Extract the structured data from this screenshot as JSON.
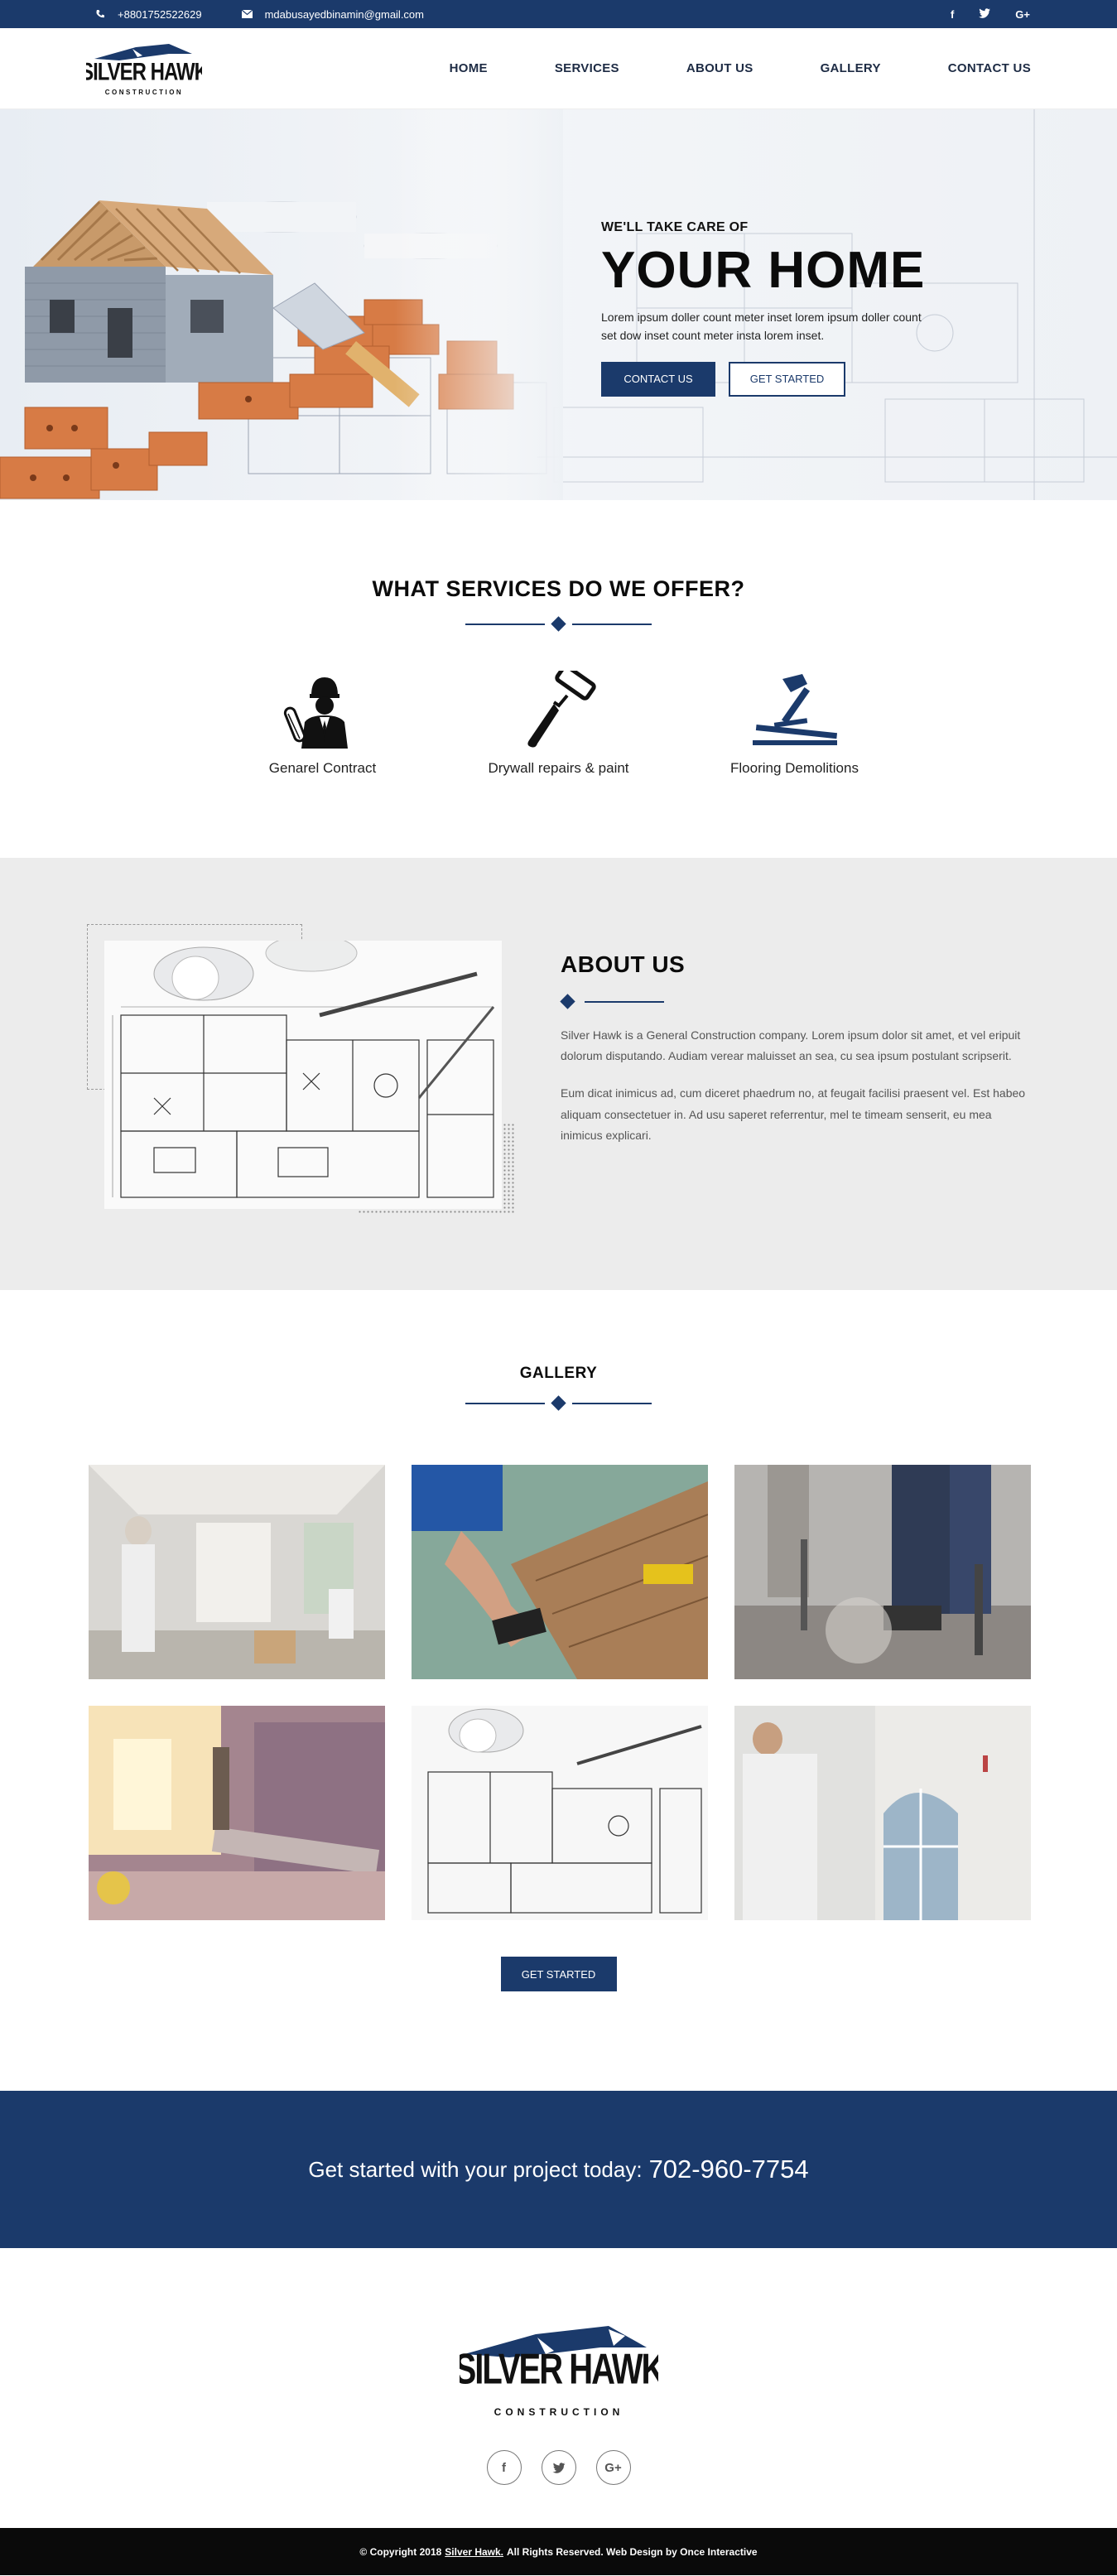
{
  "topbar": {
    "phone": "+8801752522629",
    "email": "mdabusayedbinamin@gmail.com",
    "social": [
      "f",
      "t",
      "G+"
    ]
  },
  "brand": {
    "name": "SILVER HAWK",
    "tagline": "CONSTRUCTION"
  },
  "nav": {
    "items": [
      "HOME",
      "SERVICES",
      "ABOUT US",
      "GALLERY",
      "CONTACT US"
    ]
  },
  "hero": {
    "kicker": "WE'LL TAKE CARE OF",
    "title": "YOUR HOME",
    "desc": "Lorem ipsum doller count meter inset lorem ipsum doller count set dow inset count meter insta lorem inset.",
    "btn_contact": "CONTACT US",
    "btn_started": "GET STARTED"
  },
  "services": {
    "title": "WHAT SERVICES DO WE OFFER?",
    "items": [
      {
        "label": "Genarel Contract",
        "icon": "worker-icon"
      },
      {
        "label": "Drywall repairs & paint",
        "icon": "paint-roller-icon"
      },
      {
        "label": "Flooring Demolitions",
        "icon": "hammer-icon"
      }
    ]
  },
  "about": {
    "title": "ABOUT US",
    "p1": "Silver Hawk is a General Construction company. Lorem ipsum dolor sit amet, et vel eripuit dolorum disputando. Audiam verear maluisset an sea, cu sea ipsum postulant scripserit.",
    "p2": "Eum dicat inimicus ad, cum diceret phaedrum no, at feugait facilisi praesent vel. Est habeo aliquam consectetuer in. Ad usu saperet referrentur, mel te timeam senserit, eu mea inimicus explicari."
  },
  "gallery": {
    "title": "GALLERY",
    "btn": "GET STARTED"
  },
  "cta": {
    "text": "Get started with your project today:",
    "phone": "702-960-7754"
  },
  "footer": {
    "social": [
      "f",
      "t",
      "G+"
    ],
    "copyright_pre": "© Copyright 2018",
    "copyright_brand": "Silver Hawk.",
    "copyright_post": "All Rights Reserved. Web Design by Once Interactive"
  },
  "colors": {
    "primary": "#1b3a6b",
    "dark": "#0a0a0a",
    "about_bg": "#ececec"
  }
}
